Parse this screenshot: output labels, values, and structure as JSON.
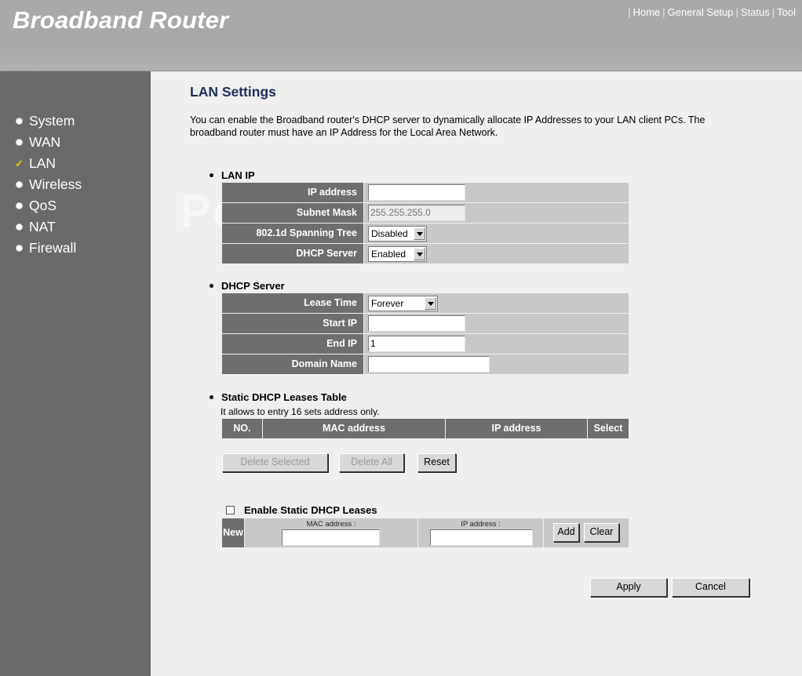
{
  "header": {
    "brand": "Broadband Router",
    "nav": [
      "Home",
      "General Setup",
      "Status",
      "Tool"
    ]
  },
  "sidebar": {
    "items": [
      {
        "label": "System",
        "marker": "bullet"
      },
      {
        "label": "WAN",
        "marker": "bullet"
      },
      {
        "label": "LAN",
        "marker": "check-icon"
      },
      {
        "label": "Wireless",
        "marker": "bullet"
      },
      {
        "label": "QoS",
        "marker": "bullet"
      },
      {
        "label": "NAT",
        "marker": "bullet"
      },
      {
        "label": "Firewall",
        "marker": "bullet"
      }
    ]
  },
  "main": {
    "title": "LAN Settings",
    "intro": "You can enable the Broadband router's DHCP server to dynamically allocate IP Addresses to your LAN client PCs. The broadband router must have an IP Address for the Local Area Network.",
    "watermark": "PcWinTech.com",
    "lan_ip": {
      "heading": "LAN IP",
      "ip_label": "IP address",
      "ip_value": "",
      "mask_label": "Subnet Mask",
      "mask_value": "255.255.255.0",
      "stp_label": "802.1d Spanning Tree",
      "stp_value": "Disabled",
      "dhcp_label": "DHCP Server",
      "dhcp_value": "Enabled"
    },
    "dhcp_server": {
      "heading": "DHCP Server",
      "lease_label": "Lease Time",
      "lease_value": "Forever",
      "start_label": "Start IP",
      "start_value": "",
      "end_label": "End IP",
      "end_value": "1",
      "domain_label": "Domain Name",
      "domain_value": ""
    },
    "static_table": {
      "heading": "Static DHCP Leases Table",
      "note": "It allows to entry 16 sets address only.",
      "columns": [
        "NO.",
        "MAC address",
        "IP address",
        "Select"
      ],
      "delete_selected": "Delete Selected",
      "delete_all": "Delete All",
      "reset": "Reset"
    },
    "static_new": {
      "enable_label": "Enable Static DHCP Leases",
      "new_label": "New",
      "mac_caption": "MAC address :",
      "ip_caption": "IP address :",
      "add": "Add",
      "clear": "Clear"
    },
    "apply": "Apply",
    "cancel": "Cancel"
  }
}
